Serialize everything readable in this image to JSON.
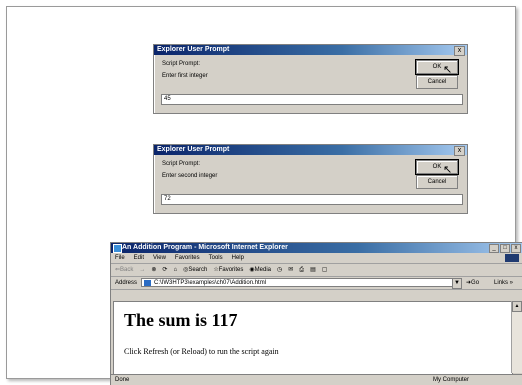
{
  "dialogs": [
    {
      "title": "Explorer User Prompt",
      "close_glyph": "x",
      "prompt_label": "Script Prompt:",
      "message": "Enter first integer",
      "ok_label": "OK",
      "cancel_label": "Cancel",
      "input_value": "45"
    },
    {
      "title": "Explorer User Prompt",
      "close_glyph": "x",
      "prompt_label": "Script Prompt:",
      "message": "Enter second integer",
      "ok_label": "OK",
      "cancel_label": "Cancel",
      "input_value": "72"
    }
  ],
  "ie": {
    "title": "An Addition Program - Microsoft Internet Explorer",
    "window_buttons": [
      "_",
      "□",
      "x"
    ],
    "menu": [
      "File",
      "Edit",
      "View",
      "Favorites",
      "Tools",
      "Help"
    ],
    "toolbar": {
      "back": "⇐Back",
      "forward": "→",
      "search": "Search",
      "favorites": "Favorites",
      "media": "Media"
    },
    "address_label": "Address",
    "address_value": "C:\\IW3HTP3\\examples\\ch07\\Addition.html",
    "go_label": "Go",
    "links_label": "Links »",
    "heading": "The sum is 117",
    "paragraph": "Click Refresh (or Reload) to run the script again",
    "status_left": "Done",
    "status_right": "My Computer"
  }
}
